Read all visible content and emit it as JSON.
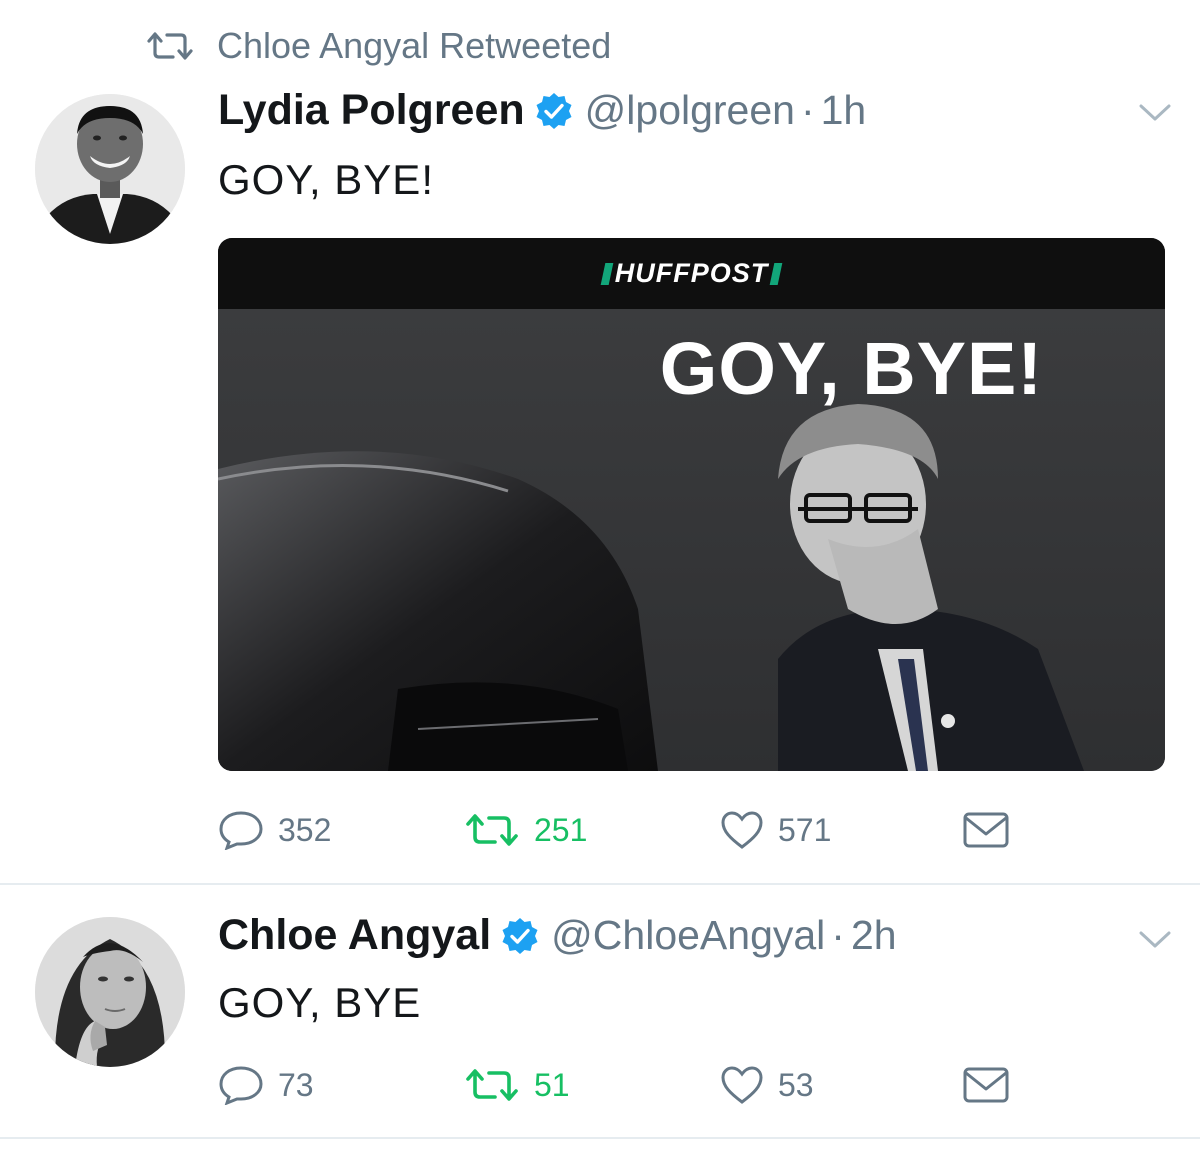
{
  "retweet_context": {
    "text": "Chloe Angyal Retweeted",
    "icon": "retweet-icon"
  },
  "tweets": [
    {
      "author_name": "Lydia Polgreen",
      "handle": "@lpolgreen",
      "separator": "·",
      "time": "1h",
      "verified": true,
      "text": "GOY, BYE!",
      "media": {
        "brand": "HUFFPOST",
        "headline": "GOY, BYE!"
      },
      "replies": "352",
      "retweets": "251",
      "likes": "571"
    },
    {
      "author_name": "Chloe Angyal",
      "handle": "@ChloeAngyal",
      "separator": "·",
      "time": "2h",
      "verified": true,
      "text": "GOY, BYE",
      "replies": "73",
      "retweets": "51",
      "likes": "53"
    }
  ],
  "colors": {
    "verified_blue": "#1da1f2",
    "retweet_green": "#17bf63",
    "muted_gray": "#657786",
    "text": "#14171a",
    "divider": "#e6ecf0"
  }
}
